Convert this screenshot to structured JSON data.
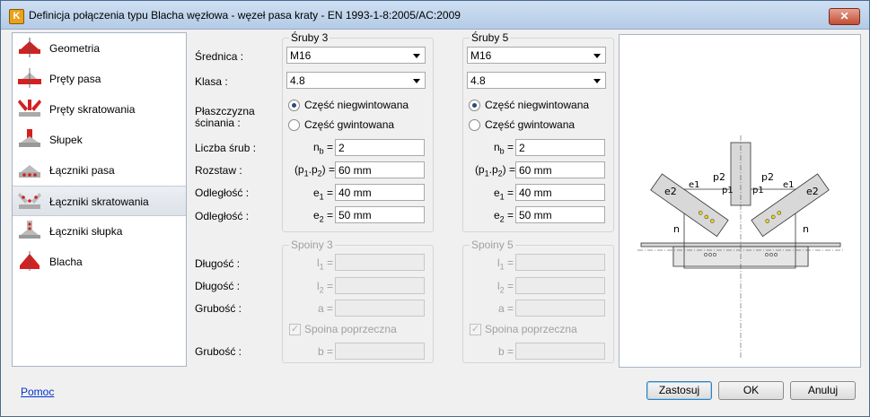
{
  "window": {
    "title": "Definicja połączenia typu Blacha węzłowa - węzeł pasa kraty - EN 1993-1-8:2005/AC:2009",
    "app_icon_letter": "K",
    "close_glyph": "✕"
  },
  "sidebar": {
    "items": [
      {
        "label": "Geometria",
        "icon": "geometry-icon"
      },
      {
        "label": "Pręty pasa",
        "icon": "chord-members-icon"
      },
      {
        "label": "Pręty skratowania",
        "icon": "web-members-icon"
      },
      {
        "label": "Słupek",
        "icon": "post-icon"
      },
      {
        "label": "Łączniki pasa",
        "icon": "chord-connectors-icon"
      },
      {
        "label": "Łączniki skratowania",
        "icon": "web-connectors-icon",
        "selected": true
      },
      {
        "label": "Łączniki słupka",
        "icon": "post-connectors-icon"
      },
      {
        "label": "Blacha",
        "icon": "plate-icon"
      }
    ]
  },
  "labels": {
    "diameter": "Średnica :",
    "class": "Klasa :",
    "shear_plane_1": "Płaszczyzna",
    "shear_plane_2": "ścinania :",
    "bolt_count": "Liczba śrub :",
    "spacing": "Rozstaw :",
    "distance1": "Odległość :",
    "distance2": "Odległość :",
    "length1": "Długość :",
    "length2": "Długość :",
    "thickness1": "Grubość :",
    "thickness2": "Grubość :"
  },
  "bolts": [
    {
      "title": "Śruby 3",
      "diameter": "M16",
      "class": "4.8",
      "radio_unthreaded": "Część niegwintowana",
      "radio_threaded": "Część gwintowana",
      "selected_radio": "unthreaded",
      "nb": "2",
      "p": "60 mm",
      "e1": "40 mm",
      "e2": "50 mm"
    },
    {
      "title": "Śruby 5",
      "diameter": "M16",
      "class": "4.8",
      "radio_unthreaded": "Część niegwintowana",
      "radio_threaded": "Część gwintowana",
      "selected_radio": "unthreaded",
      "nb": "2",
      "p": "60 mm",
      "e1": "40 mm",
      "e2": "50 mm"
    }
  ],
  "welds": [
    {
      "title": "Spoiny 3",
      "l1": "",
      "l2": "",
      "a": "",
      "b": "",
      "transverse_label": "Spoina poprzeczna",
      "transverse_checked": true
    },
    {
      "title": "Spoiny 5",
      "l1": "",
      "l2": "",
      "a": "",
      "b": "",
      "transverse_label": "Spoina poprzeczna",
      "transverse_checked": true
    }
  ],
  "symbols": {
    "nb": "n",
    "nb_sub": "b",
    "p_open": "(p",
    "p1_sub": "1",
    "p_mid": ".p",
    "p2_sub": "2",
    "p_close": ") =",
    "e": "e",
    "e1_sub": "1",
    "e2_sub": "2",
    "l": "l",
    "l1_sub": "1",
    "l2_sub": "2",
    "a": "a =",
    "b": "b =",
    "eq": " ="
  },
  "diagram": {
    "p2_left": "p2",
    "p1_left": "p1",
    "e2_left": "e2",
    "e1_left": "e1",
    "n_left": "n",
    "p2_right": "p2",
    "p1_right": "p1",
    "e2_right": "e2",
    "e1_right": "e1",
    "n_right": "n"
  },
  "footer": {
    "help": "Pomoc",
    "apply": "Zastosuj",
    "ok": "OK",
    "cancel": "Anuluj"
  },
  "colors": {
    "accent_red": "#d42020",
    "diagram_fill": "#d8d8d8",
    "bolt_yellow": "#f0d020"
  }
}
